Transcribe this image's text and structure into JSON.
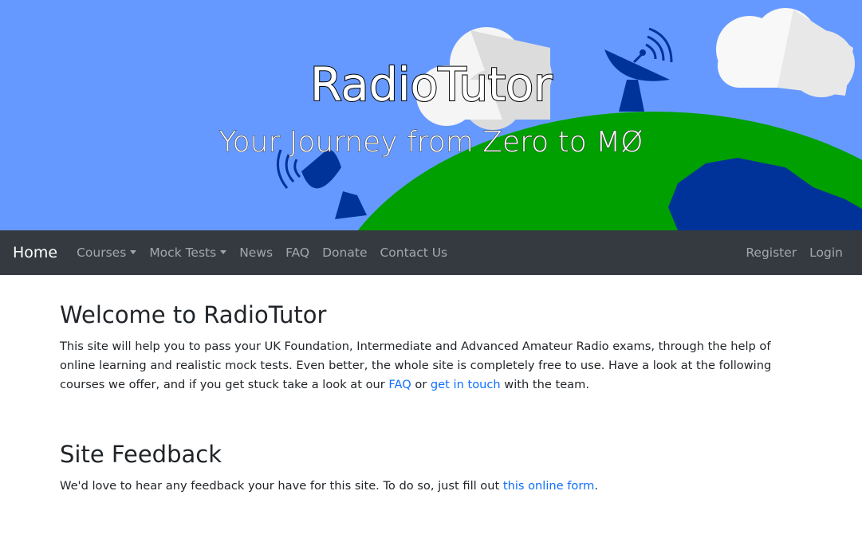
{
  "banner": {
    "title": "RadioTutor",
    "tagline": "Your Journey from Zero to MØ",
    "colors": {
      "sky": "#6699ff",
      "earth": "#00a000",
      "land": "#003399",
      "cloud": "#f5f5f5",
      "dish": "#003399"
    }
  },
  "navbar": {
    "brand": "Home",
    "items": [
      {
        "label": "Courses",
        "dropdown": true
      },
      {
        "label": "Mock Tests",
        "dropdown": true
      },
      {
        "label": "News",
        "dropdown": false
      },
      {
        "label": "FAQ",
        "dropdown": false
      },
      {
        "label": "Donate",
        "dropdown": false
      },
      {
        "label": "Contact Us",
        "dropdown": false
      }
    ],
    "right_items": [
      {
        "label": "Register"
      },
      {
        "label": "Login"
      }
    ]
  },
  "welcome": {
    "heading": "Welcome to RadioTutor",
    "text_before": "This site will help you to pass your UK Foundation, Intermediate and Advanced Amateur Radio exams, through the help of online learning and realistic mock tests. Even better, the whole site is completely free to use. Have a look at the following courses we offer, and if you get stuck take a look at our ",
    "faq_link": "FAQ",
    "text_middle": " or ",
    "contact_link": "get in touch",
    "text_after": " with the team."
  },
  "feedback": {
    "heading": "Site Feedback",
    "text_before": "We'd love to hear any feedback your have for this site. To do so, just fill out ",
    "form_link": "this online form",
    "text_after": "."
  }
}
